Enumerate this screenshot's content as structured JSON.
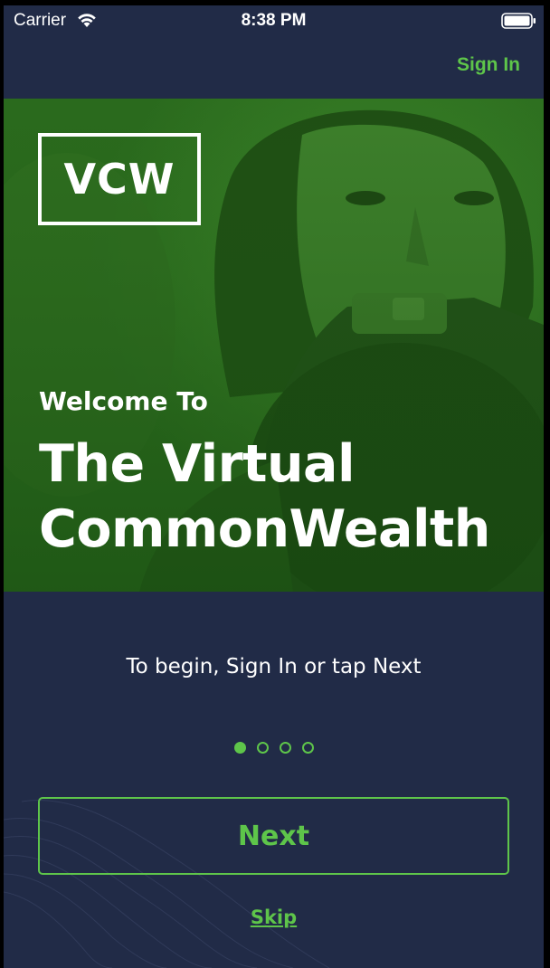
{
  "status_bar": {
    "carrier": "Carrier",
    "time": "8:38 PM",
    "wifi_icon": "wifi-icon",
    "battery_icon": "battery-icon"
  },
  "nav": {
    "sign_in_label": "Sign In"
  },
  "hero": {
    "logo_text": "VCW",
    "welcome": "Welcome To",
    "title_line1": "The Virtual",
    "title_line2": "CommonWealth",
    "image": "woman-with-megaphone-photo"
  },
  "main": {
    "instruction": "To begin, Sign In or tap Next",
    "pagination": {
      "current_page": 1,
      "total_pages": 4
    },
    "next_label": "Next",
    "skip_label": "Skip"
  },
  "colors": {
    "background": "#212b47",
    "accent": "#5ec54a",
    "hero_tint": "#2b6a1e"
  }
}
